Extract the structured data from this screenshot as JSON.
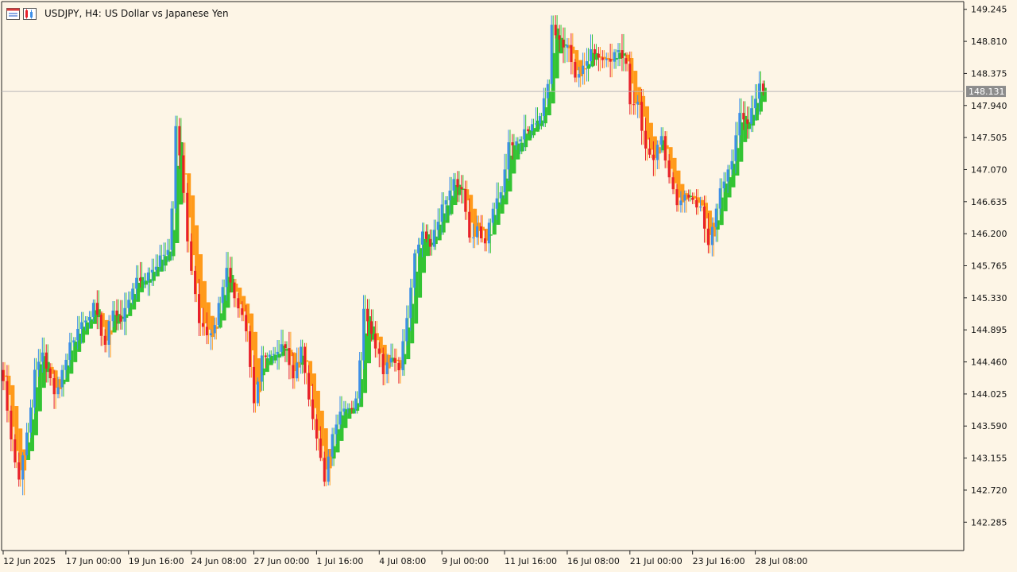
{
  "header": {
    "symbol_text": "USDJPY, H4:",
    "description": "US Dollar vs Japanese Yen",
    "icons": [
      "chart-window-icon",
      "chart-properties-icon"
    ]
  },
  "current_price": "148.131",
  "colors": {
    "background": "#fdf5e6",
    "up_candle": "#3d8fe8",
    "down_candle": "#e8202a",
    "heiken_up": "#33c433",
    "heiken_down": "#ff9a1a",
    "price_line": "#b8b8b8",
    "price_badge": "#8c8c8c",
    "axis": "#222222"
  },
  "chart_data": {
    "type": "candlestick",
    "symbol": "USDJPY",
    "timeframe": "H4",
    "y_ticks": [
      "149.245",
      "148.810",
      "148.375",
      "147.940",
      "147.505",
      "147.070",
      "146.635",
      "146.200",
      "145.765",
      "145.330",
      "144.895",
      "144.460",
      "144.025",
      "143.590",
      "143.155",
      "142.720",
      "142.285"
    ],
    "x_ticks": [
      "12 Jun 2025",
      "17 Jun 00:00",
      "19 Jun 16:00",
      "24 Jun 08:00",
      "27 Jun 00:00",
      "1 Jul 16:00",
      "4 Jul 08:00",
      "9 Jul 00:00",
      "11 Jul 16:00",
      "16 Jul 08:00",
      "21 Jul 00:00",
      "23 Jul 16:00",
      "28 Jul 08:00"
    ],
    "ylim": [
      141.9,
      149.35
    ],
    "anchors": [
      [
        0,
        144.2
      ],
      [
        2,
        143.4
      ],
      [
        4,
        142.9
      ],
      [
        6,
        143.5
      ],
      [
        8,
        144.3
      ],
      [
        10,
        144.6
      ],
      [
        13,
        144.0
      ],
      [
        17,
        144.7
      ],
      [
        20,
        145.0
      ],
      [
        23,
        145.2
      ],
      [
        26,
        144.7
      ],
      [
        28,
        145.2
      ],
      [
        30,
        145.0
      ],
      [
        33,
        145.5
      ],
      [
        36,
        145.6
      ],
      [
        39,
        145.8
      ],
      [
        42,
        146.0
      ],
      [
        43,
        146.6
      ],
      [
        44,
        147.6
      ],
      [
        45,
        147.3
      ],
      [
        47,
        146.1
      ],
      [
        50,
        145.0
      ],
      [
        52,
        144.8
      ],
      [
        54,
        145.0
      ],
      [
        57,
        145.8
      ],
      [
        59,
        145.3
      ],
      [
        62,
        144.9
      ],
      [
        64,
        143.9
      ],
      [
        66,
        144.5
      ],
      [
        69,
        144.6
      ],
      [
        72,
        144.7
      ],
      [
        74,
        144.2
      ],
      [
        76,
        144.6
      ],
      [
        78,
        143.9
      ],
      [
        80,
        143.4
      ],
      [
        82,
        142.9
      ],
      [
        84,
        143.5
      ],
      [
        86,
        143.8
      ],
      [
        88,
        143.8
      ],
      [
        90,
        143.9
      ],
      [
        92,
        145.2
      ],
      [
        93,
        145.0
      ],
      [
        95,
        144.7
      ],
      [
        97,
        144.3
      ],
      [
        99,
        144.5
      ],
      [
        101,
        144.4
      ],
      [
        103,
        145.0
      ],
      [
        105,
        146.0
      ],
      [
        107,
        146.2
      ],
      [
        109,
        146.0
      ],
      [
        111,
        146.4
      ],
      [
        113,
        146.7
      ],
      [
        115,
        147.0
      ],
      [
        117,
        146.8
      ],
      [
        119,
        146.1
      ],
      [
        121,
        146.3
      ],
      [
        123,
        146.1
      ],
      [
        125,
        146.6
      ],
      [
        127,
        146.8
      ],
      [
        129,
        147.4
      ],
      [
        131,
        147.5
      ],
      [
        133,
        147.6
      ],
      [
        135,
        147.7
      ],
      [
        137,
        147.8
      ],
      [
        139,
        148.3
      ],
      [
        140,
        149.0
      ],
      [
        142,
        148.8
      ],
      [
        144,
        148.7
      ],
      [
        146,
        148.3
      ],
      [
        147,
        148.4
      ],
      [
        149,
        148.6
      ],
      [
        151,
        148.7
      ],
      [
        153,
        148.6
      ],
      [
        155,
        148.6
      ],
      [
        157,
        148.7
      ],
      [
        159,
        148.5
      ],
      [
        160,
        147.9
      ],
      [
        162,
        148.0
      ],
      [
        164,
        147.3
      ],
      [
        166,
        147.2
      ],
      [
        168,
        147.5
      ],
      [
        170,
        146.9
      ],
      [
        172,
        146.6
      ],
      [
        174,
        146.7
      ],
      [
        176,
        146.6
      ],
      [
        178,
        146.5
      ],
      [
        180,
        146.0
      ],
      [
        182,
        146.6
      ],
      [
        184,
        146.9
      ],
      [
        186,
        147.2
      ],
      [
        188,
        147.8
      ],
      [
        190,
        147.7
      ],
      [
        192,
        148.0
      ],
      [
        193,
        148.3
      ],
      [
        194,
        148.131
      ]
    ]
  }
}
